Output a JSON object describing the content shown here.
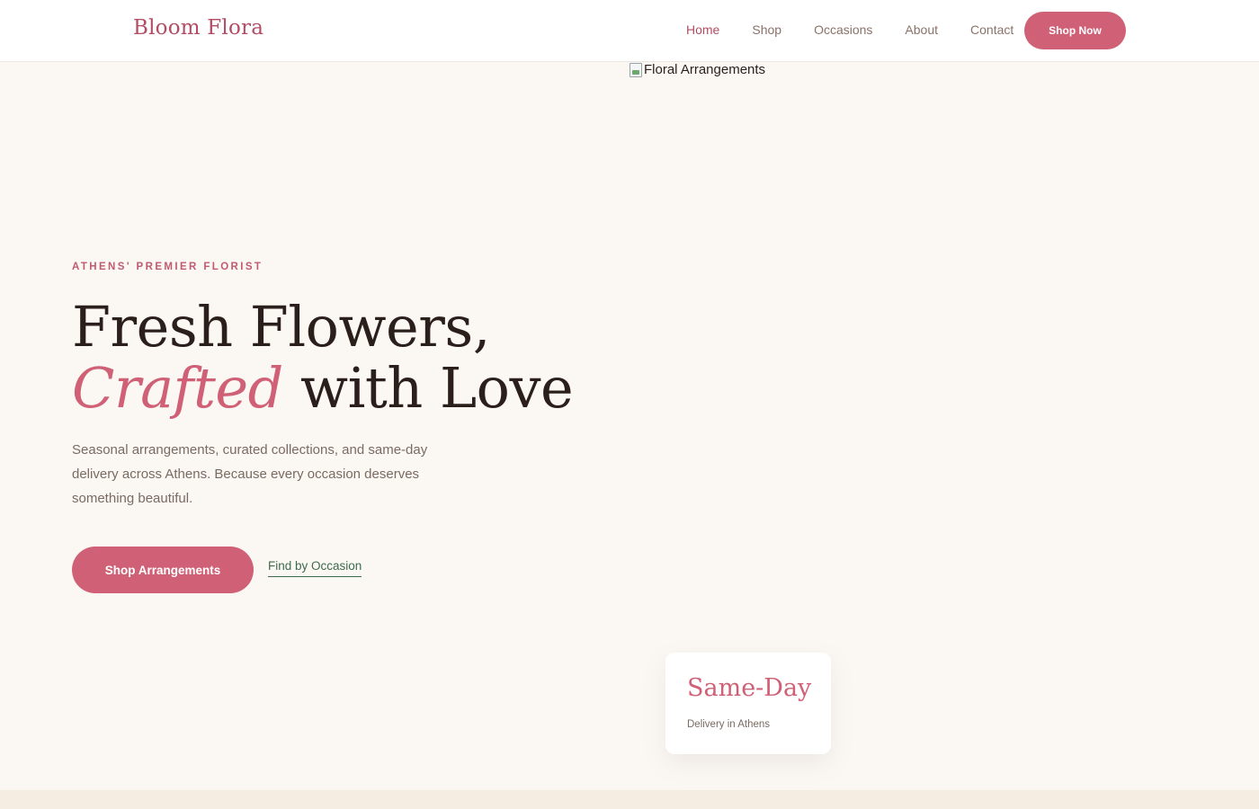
{
  "header": {
    "logo": "Bloom Flora",
    "nav": [
      {
        "label": "Home",
        "active": true
      },
      {
        "label": "Shop",
        "active": false
      },
      {
        "label": "Occasions",
        "active": false
      },
      {
        "label": "About",
        "active": false
      },
      {
        "label": "Contact",
        "active": false
      }
    ],
    "cta_label": "Shop Now"
  },
  "hero": {
    "image_alt": "Floral Arrangements",
    "eyebrow": "ATHENS' PREMIER FLORIST",
    "headline_line1": "Fresh Flowers,",
    "headline_accent": "Crafted",
    "headline_line2_rest": " with Love",
    "lead": "Seasonal arrangements, curated collections, and same-day delivery across Athens. Because every occasion deserves something beautiful.",
    "primary_cta": "Shop Arrangements",
    "secondary_cta": "Find by Occasion"
  },
  "badge": {
    "title": "Same-Day",
    "subtitle": "Delivery in Athens"
  },
  "colors": {
    "brand": "#d06076",
    "logo": "#b24d64",
    "background": "#fbf8f4",
    "link_green": "#3c6a4c"
  }
}
